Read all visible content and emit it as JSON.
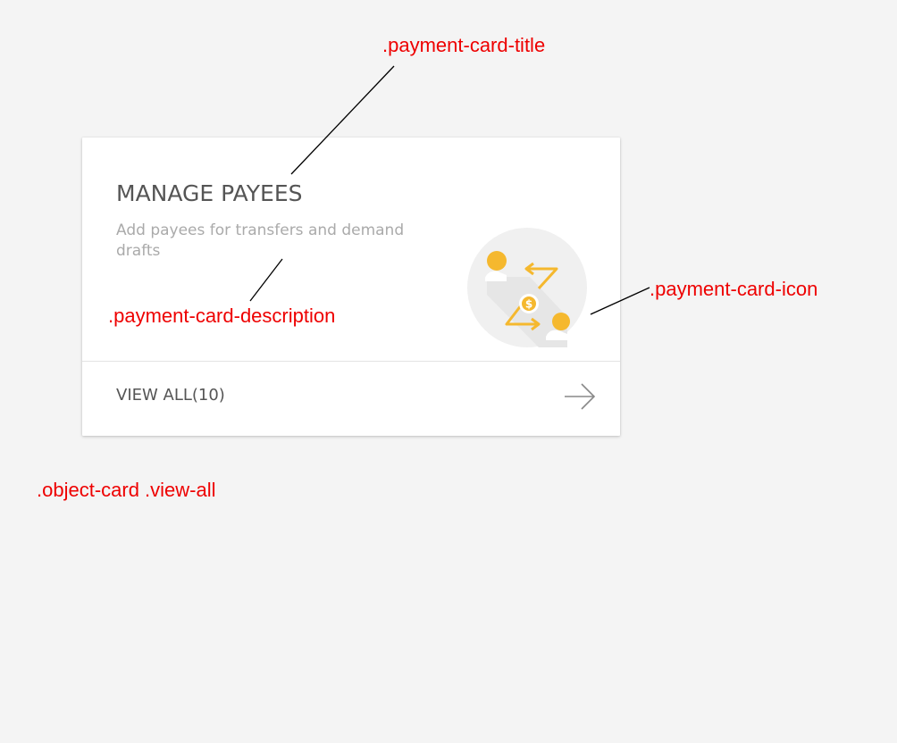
{
  "card": {
    "title": "MANAGE PAYEES",
    "description": "Add payees for transfers and demand drafts",
    "icon": "payee-transfer-icon",
    "icon_currency_symbol": "$",
    "view_all_label": "VIEW ALL(10)",
    "view_all_icon": "arrow-right-icon"
  },
  "annotations": {
    "title": ".payment-card-title",
    "description": ".payment-card-description",
    "icon": ".payment-card-icon",
    "view_all": ".object-card .view-all"
  },
  "colors": {
    "background": "#f4f4f4",
    "card": "#ffffff",
    "title_text": "#555555",
    "description_text": "#aaaaaa",
    "icon_accent": "#f5b82e",
    "icon_circle": "#f0f0f0",
    "annotation": "#ee0000"
  }
}
